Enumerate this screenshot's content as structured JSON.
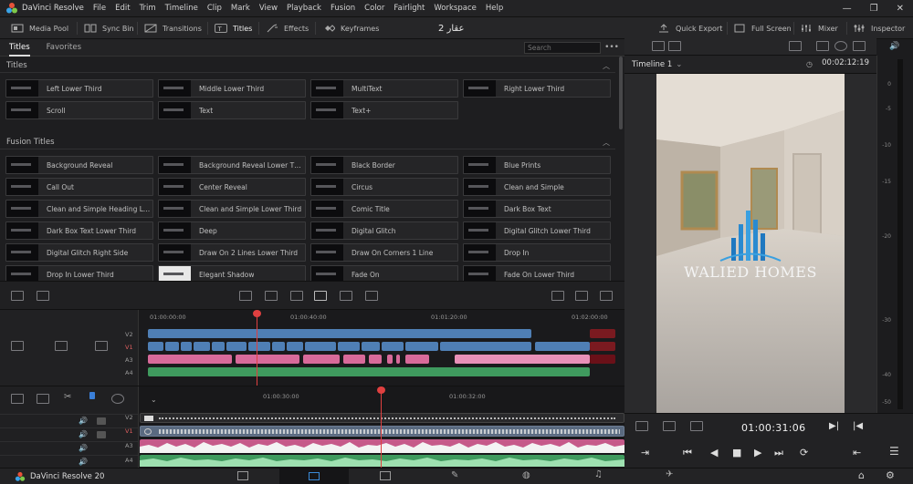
{
  "app": {
    "name": "DaVinci Resolve",
    "menu": [
      "File",
      "Edit",
      "Trim",
      "Timeline",
      "Clip",
      "Mark",
      "View",
      "Playback",
      "Fusion",
      "Color",
      "Fairlight",
      "Workspace",
      "Help"
    ],
    "project_name": "عقار 2"
  },
  "toolbar": {
    "media_pool": "Media Pool",
    "sync_bin": "Sync Bin",
    "transitions": "Transitions",
    "titles": "Titles",
    "effects": "Effects",
    "keyframes": "Keyframes",
    "quick_export": "Quick Export",
    "full_screen": "Full Screen",
    "mixer": "Mixer",
    "inspector": "Inspector"
  },
  "browser": {
    "tabs": [
      "Titles",
      "Favorites"
    ],
    "search_placeholder": "Search",
    "sections": [
      {
        "title": "Titles",
        "items": [
          "Left Lower Third",
          "Middle Lower Third",
          "MultiText",
          "Right Lower Third",
          "Scroll",
          "Text",
          "Text+"
        ]
      },
      {
        "title": "Fusion Titles",
        "items": [
          "Background Reveal",
          "Background Reveal Lower Th...",
          "Black Border",
          "Blue Prints",
          "Call Out",
          "Center Reveal",
          "Circus",
          "Clean and Simple",
          "Clean and Simple Heading Lo...",
          "Clean and Simple Lower Third",
          "Comic Title",
          "Dark Box Text",
          "Dark Box Text Lower Third",
          "Deep",
          "Digital Glitch",
          "Digital Glitch Lower Third",
          "Digital Glitch Right Side",
          "Draw On 2 Lines Lower Third",
          "Draw On Corners 1 Line",
          "Drop In",
          "Drop In Lower Third",
          "Elegant Shadow",
          "Fade On",
          "Fade On Lower Third"
        ]
      }
    ]
  },
  "timeline": {
    "name": "Timeline 1",
    "duration_tc": "00:02:12:19",
    "current_tc": "01:00:31:06",
    "upper_ruler": [
      "01:00:00:00",
      "01:00:40:00",
      "01:01:20:00",
      "01:02:00:00"
    ],
    "lower_ruler": [
      "01:00:30:00",
      "01:00:32:00"
    ],
    "upper_tracks": [
      "V2",
      "V1",
      "A3",
      "A4"
    ],
    "lower_tracks": [
      "V2",
      "V1",
      "A3",
      "A4"
    ]
  },
  "viewer": {
    "watermark": "WALIED HOMES"
  },
  "meters": {
    "scale": [
      "0",
      "-5",
      "-10",
      "-15",
      "-20",
      "-30",
      "-40",
      "-50"
    ]
  },
  "pagebar": {
    "brand": "DaVinci Resolve 20"
  },
  "colors": {
    "video_clip": "#4f7fb5",
    "audio_clip_a3": "#d86a9a",
    "audio_clip_a4": "#3f9a5e",
    "playhead": "#e04040"
  }
}
